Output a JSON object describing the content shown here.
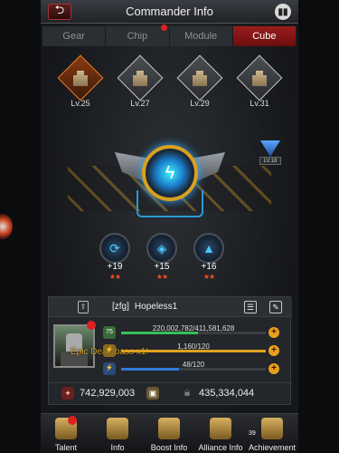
{
  "header": {
    "title": "Commander Info",
    "back_icon": "back-arrow-icon",
    "stats_icon": "stats-icon"
  },
  "tabs": [
    {
      "label": "Gear",
      "active": false,
      "badge": false
    },
    {
      "label": "Chip",
      "active": false,
      "badge": true
    },
    {
      "label": "Module",
      "active": false,
      "badge": false
    },
    {
      "label": "Cube",
      "active": true,
      "badge": false
    }
  ],
  "cubes": [
    {
      "level": "Lv.25",
      "selected": true
    },
    {
      "level": "Lv.27",
      "selected": false
    },
    {
      "level": "Lv.29",
      "selected": false
    },
    {
      "level": "Lv.31",
      "selected": false
    }
  ],
  "rank_badge": {
    "level": "LV.18"
  },
  "core": {
    "icon": "energy-core-icon"
  },
  "slots": [
    {
      "bonus": "+19",
      "stars": "★★"
    },
    {
      "bonus": "+15",
      "stars": "★★"
    },
    {
      "bonus": "+16",
      "stars": "★★"
    }
  ],
  "player": {
    "alliance_tag": "[zfg]",
    "name": "Hopeless1",
    "title_label": "Epic Deathbass x1!",
    "level_badge": "75"
  },
  "stats": [
    {
      "text": "220,002,782/411,581,628",
      "fraction": 0.53,
      "color": "#35c05a"
    },
    {
      "text": "1,160/120",
      "fraction": 1.0,
      "color": "#e0a020"
    },
    {
      "text": "48/120",
      "fraction": 0.4,
      "color": "#2e7ad8"
    }
  ],
  "power": {
    "left_value": "742,929,003",
    "right_value": "435,334,044"
  },
  "nav": [
    {
      "label": "Talent",
      "badge": true
    },
    {
      "label": "Info",
      "badge": false
    },
    {
      "label": "Boost Info",
      "badge": false
    },
    {
      "label": "Alliance Info",
      "badge": false
    },
    {
      "label": "Achievement",
      "badge": false,
      "count": "39"
    }
  ]
}
